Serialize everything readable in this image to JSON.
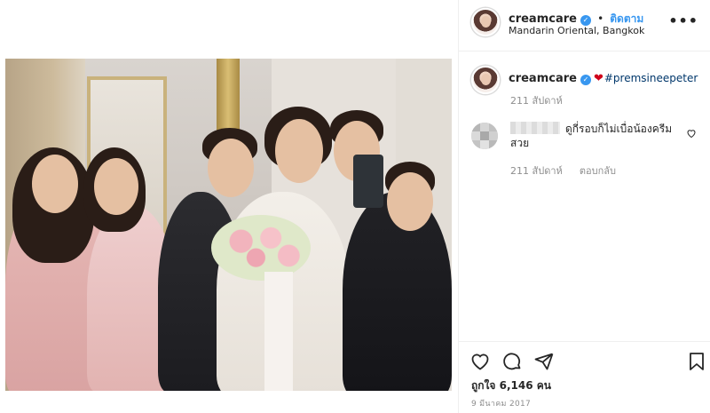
{
  "post": {
    "username": "creamcare",
    "follow_label": "ติดตาม",
    "location": "Mandarin Oriental, Bangkok",
    "caption": {
      "username": "creamcare",
      "hashtag": "#premsineepeter",
      "time_ago": "211 สัปดาห์"
    },
    "comment": {
      "text": "ดูกี่รอบก็ไม่เบื่อน้องครีมสวย",
      "time_ago": "211 สัปดาห์",
      "reply_label": "ตอบกลับ"
    },
    "likes": "ถูกใจ 6,146 คน",
    "date": "9 มีนาคม 2017"
  },
  "icons": {
    "verified": "verified-badge-icon",
    "more": "more-options-icon",
    "heart": "heart-icon",
    "comment": "comment-icon",
    "share": "share-icon",
    "save": "bookmark-icon",
    "emoji_heart": "red-heart-emoji"
  },
  "colors": {
    "accent": "#3897f0",
    "text": "#262626",
    "muted": "#8e8e8e",
    "hashtag": "#00376b"
  }
}
